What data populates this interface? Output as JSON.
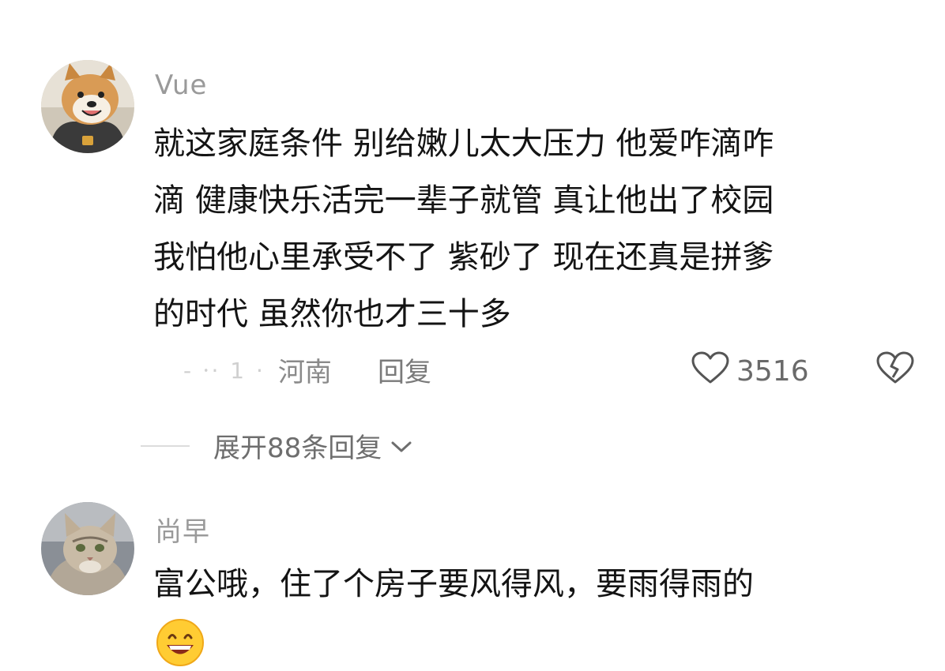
{
  "comments": [
    {
      "username": "Vue",
      "avatar_icon": "shiba-dog-avatar",
      "lines": [
        "就这家庭条件 别给嫩儿太大压力 他爱咋滴咋",
        "滴 健康快乐活完一辈子就管 真让他出了校园",
        "我怕他心里承受不了 紫砂了 现在还真是拼爹",
        "的时代 虽然你也才三十多"
      ],
      "time_blurred": "- ⸱· 1 ·",
      "location": "河南",
      "reply_label": "回复",
      "likes": "3516",
      "like_icon": "heart-outline-icon",
      "dislike_icon": "broken-heart-icon"
    },
    {
      "username": "尚早",
      "avatar_icon": "cat-avatar",
      "lines": [
        "富公哦，住了个房子要风得风，要雨得雨的"
      ],
      "emoji": "grinning-face-emoji"
    }
  ],
  "expand_replies_label": "展开88条回复",
  "expand_icon": "chevron-down-icon",
  "colors": {
    "text": "#141414",
    "muted": "#9a9a9a",
    "background": "#ffffff"
  }
}
